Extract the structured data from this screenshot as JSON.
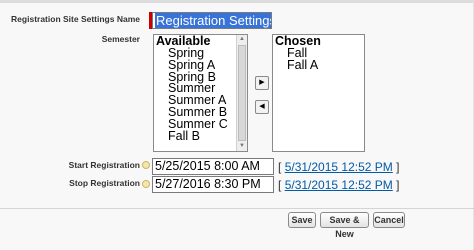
{
  "form": {
    "name_label": "Registration Site Settings Name",
    "name_value": "Registration Settings",
    "semester_label": "Semester",
    "available_header": "Available",
    "available_options": [
      "Spring",
      "Spring A",
      "Spring B",
      "Summer",
      "Summer A",
      "Summer B",
      "Summer C",
      "Fall B"
    ],
    "chosen_header": "Chosen",
    "chosen_options": [
      "Fall",
      "Fall A"
    ],
    "add_arrow": "▶",
    "remove_arrow": "◀",
    "start_label": "Start Registration",
    "start_value": "5/25/2015 8:00 AM",
    "start_now_link": "5/31/2015 12:52 PM",
    "stop_label": "Stop Registration",
    "stop_value": "5/27/2016 8:30 PM",
    "stop_now_link": "5/31/2015 12:52 PM",
    "bracket_open": "[",
    "bracket_close": "]"
  },
  "buttons": {
    "save": "Save",
    "save_new": "Save & New",
    "cancel": "Cancel"
  },
  "colors": {
    "required": "#cc0000",
    "link": "#015ba7",
    "selection": "#3874d8"
  }
}
